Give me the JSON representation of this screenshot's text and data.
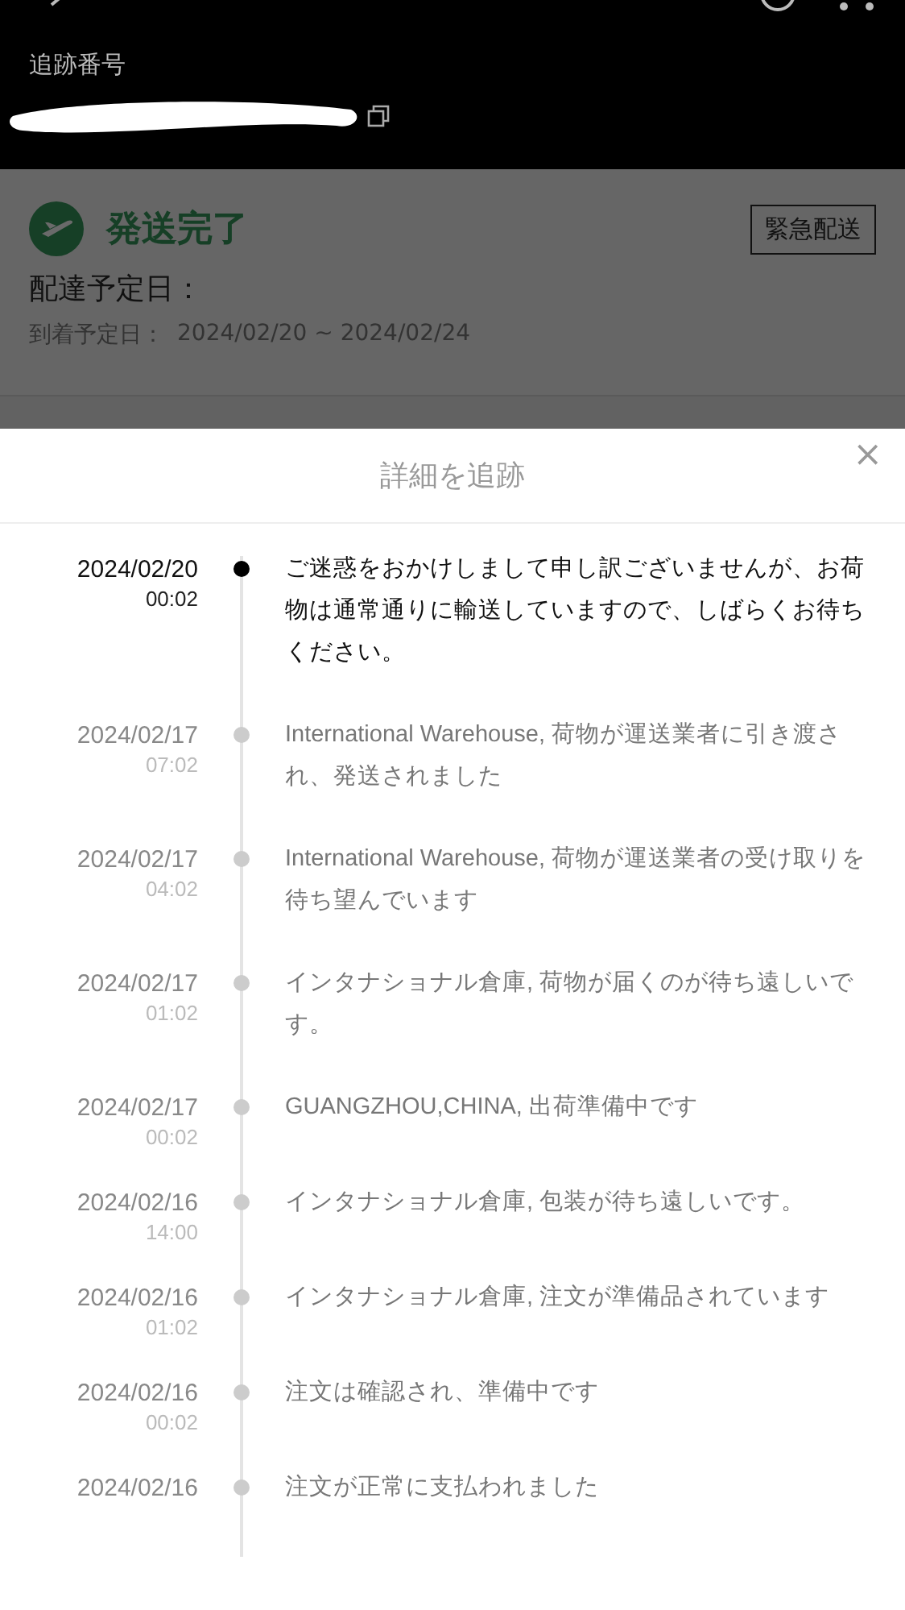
{
  "header": {
    "tracking_label": "追跡番号"
  },
  "shipment": {
    "status": "発送完了",
    "express_button": "緊急配送",
    "delivery_label": "配達予定日：",
    "eta_label": "到着予定日：",
    "eta_range": "2024/02/20 ~ 2024/02/24"
  },
  "sheet": {
    "title": "詳細を追跡",
    "close": "×"
  },
  "events": [
    {
      "date": "2024/02/20",
      "time": "00:02",
      "text": "ご迷惑をおかけしまして申し訳ございませんが、お荷物は通常通りに輸送していますので、しばらくお待ちください。",
      "current": true
    },
    {
      "date": "2024/02/17",
      "time": "07:02",
      "text": "International Warehouse, 荷物が運送業者に引き渡され、発送されました",
      "current": false
    },
    {
      "date": "2024/02/17",
      "time": "04:02",
      "text": "International Warehouse, 荷物が運送業者の受け取りを待ち望んでいます",
      "current": false
    },
    {
      "date": "2024/02/17",
      "time": "01:02",
      "text": "インタナショナル倉庫, 荷物が届くのが待ち遠しいです。",
      "current": false
    },
    {
      "date": "2024/02/17",
      "time": "00:02",
      "text": "GUANGZHOU,CHINA, 出荷準備中です",
      "current": false
    },
    {
      "date": "2024/02/16",
      "time": "14:00",
      "text": "インタナショナル倉庫, 包装が待ち遠しいです。",
      "current": false
    },
    {
      "date": "2024/02/16",
      "time": "01:02",
      "text": "インタナショナル倉庫, 注文が準備品されています",
      "current": false
    },
    {
      "date": "2024/02/16",
      "time": "00:02",
      "text": "注文は確認され、準備中です",
      "current": false
    },
    {
      "date": "2024/02/16",
      "text": "注文が正常に支払われました",
      "current": false
    }
  ]
}
